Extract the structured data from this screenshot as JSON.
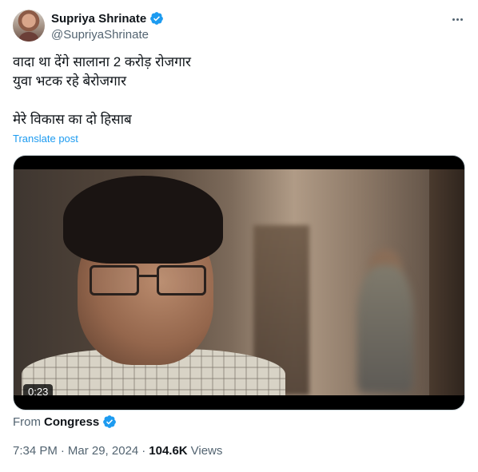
{
  "author": {
    "display_name": "Supriya Shrinate",
    "handle": "@SupriyaShrinate",
    "verified": true,
    "verified_color": "#1d9bf0"
  },
  "tweet": {
    "text": "वादा था देंगे सालाना 2 करोड़ रोजगार\nयुवा भटक रहे बेरोजगार\n\nमेरे विकास का दो हिसाब",
    "translate_label": "Translate post"
  },
  "media": {
    "type": "video",
    "duration": "0:23"
  },
  "source": {
    "from_label": "From",
    "name": "Congress",
    "verified": true
  },
  "meta": {
    "time": "7:34 PM",
    "separator": "·",
    "date": "Mar 29, 2024",
    "views_count": "104.6K",
    "views_label": "Views"
  },
  "icons": {
    "more": "more-options-icon",
    "verified": "verified-badge-icon"
  },
  "colors": {
    "link": "#1d9bf0",
    "secondary_text": "#536471",
    "primary_text": "#0f1419"
  }
}
